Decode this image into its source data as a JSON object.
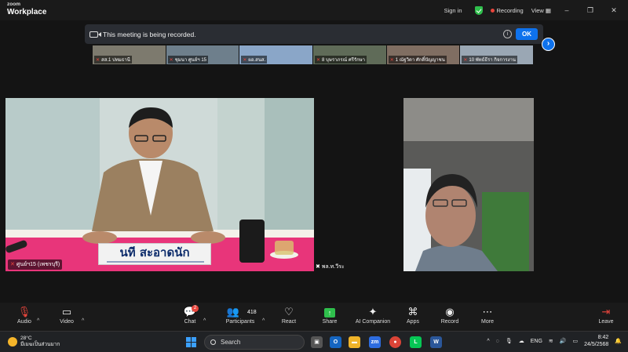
{
  "app": {
    "brand_small": "zoom",
    "brand_big": "Workplace",
    "sign_in": "Sign in",
    "recording": "Recording",
    "view": "View",
    "minimize": "–",
    "restore": "❐",
    "close": "✕"
  },
  "banner": {
    "text": "This meeting is being recorded.",
    "info": "i",
    "ok_label": "OK",
    "next": "›"
  },
  "thumbnails": [
    {
      "label": "สส.1 ปทมธานี",
      "bg": "#7d7a6e"
    },
    {
      "label": "ชุมนา ศูนย์ฯ 15",
      "bg": "#6e7f8c"
    },
    {
      "label": "ผอ.สนส.",
      "bg": "#8aa6c8"
    },
    {
      "label": "8 บุษราภรณ์ ศรีรักษา",
      "bg": "#5f6b58"
    },
    {
      "label": "1 ณัฐวิดา ศักดิ์ปัญญาชน",
      "bg": "#806e62"
    },
    {
      "label": "10 พัทธ์ธีรา กิจการงาน",
      "bg": "#9aa7b4"
    }
  ],
  "tiles": {
    "left_label": "ศูนย์ฯ15 (เพชรบุรี)",
    "right_label": "พล.ท.วีระ",
    "nameplate": "นที สะอาดนัก"
  },
  "toolbar": {
    "audio": "Audio",
    "video": "Video",
    "chat": "Chat",
    "chat_badge": "2",
    "participants": "Participants",
    "participants_count": "418",
    "react": "React",
    "share": "Share",
    "ai_companion": "AI Companion",
    "apps": "Apps",
    "record": "Record",
    "more": "More",
    "leave": "Leave"
  },
  "taskbar": {
    "temperature": "28°C",
    "weather_desc": "มีเมฆเป็นส่วนมาก",
    "search": "Search",
    "language": "ENG",
    "time": "8:42",
    "date": "24/5/2568"
  },
  "colors": {
    "accent_blue": "#0e72ed",
    "record_red": "#e8453c",
    "share_green": "#2fbf4c"
  }
}
